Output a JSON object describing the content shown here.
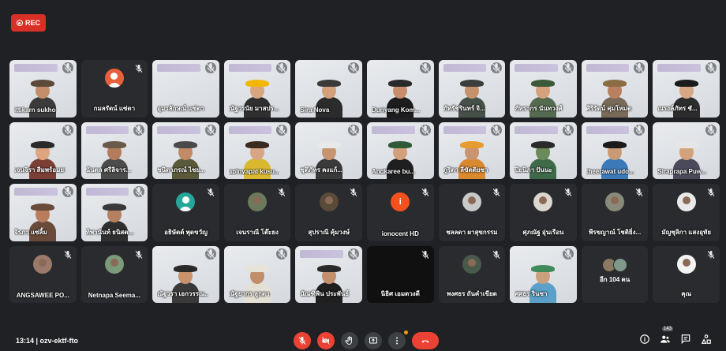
{
  "recording": {
    "label": "REC"
  },
  "meeting": {
    "time": "13:14",
    "code": "ozv-ektf-fto",
    "time_code": "13:14  |  ozv-ektf-fto"
  },
  "participants_count": "143",
  "colors": {
    "rec": "#d93025",
    "end_call": "#ea4335",
    "tile_dark": "#3c4043",
    "background": "#202124"
  },
  "participants": [
    {
      "name": "ittikarn sukho",
      "type": "video",
      "banner": true,
      "shirt": "#3b3b3b",
      "skin": "#c48e6a",
      "hat": "#5b4a3a"
    },
    {
      "name": "กมลรัตน์ แซ่ตา",
      "type": "avatar",
      "avatar_bg": "#e8603c",
      "avatar_kind": "generic"
    },
    {
      "name": "อุมาลักษณ์ แซ่ตา",
      "type": "video",
      "banner": true,
      "empty": true
    },
    {
      "name": "ณัฐวรนัย มาสปร...",
      "type": "video",
      "banner": true,
      "shirt": "#2f2f2f",
      "skin": "#d9a57e",
      "hat": "#f2b705"
    },
    {
      "name": "Sira Nova",
      "type": "video",
      "banner": false,
      "shirt": "#2b2b2b",
      "skin": "#d2a07a",
      "hat": "#3a3a3a"
    },
    {
      "name": "Duriyang Kom...",
      "type": "video",
      "banner": false,
      "shirt": "#1c1c1c",
      "skin": "#c98d6b",
      "hat": "#2a2a2a"
    },
    {
      "name": "ภัทรัชรินทร์ จิ...",
      "type": "video",
      "banner": true,
      "shirt": "#455048",
      "skin": "#c6926b",
      "hat": "#3a3f3c"
    },
    {
      "name": "ภัทรากร นันทวงศ์",
      "type": "video",
      "banner": true,
      "shirt": "#556b4f",
      "skin": "#d6a27d",
      "hat": "#3c5a3a"
    },
    {
      "name": "ศิริรัตน์ คุ่มโหมด",
      "type": "video",
      "banner": true,
      "shirt": "#7a6a5a",
      "skin": "#b88060",
      "hat": "#8a6d45"
    },
    {
      "name": "ณรงค์ภัทร ชั...",
      "type": "video",
      "banner": true,
      "shirt": "#2c2c2c",
      "skin": "#d7a684",
      "hat": "#1b1b1b"
    },
    {
      "name": "เจนจิรา สีมพร้อมยา",
      "type": "video",
      "banner": false,
      "shirt": "#7b3f35",
      "skin": "#dca47f",
      "hat": "#2a2a2a"
    },
    {
      "name": "นันตล ศรีลิจาร...",
      "type": "video",
      "banner": true,
      "shirt": "#4b4b4b",
      "skin": "#b37c5a",
      "hat": "#6a5a4a"
    },
    {
      "name": "ชนิดาภรณ์ ไชย...",
      "type": "video",
      "banner": true,
      "shirt": "#5a5a3a",
      "skin": "#c28a66",
      "hat": "#4a4a4a"
    },
    {
      "name": "apinyapat kusu...",
      "type": "video",
      "banner": true,
      "shirt": "#d9b82f",
      "skin": "#d8a684",
      "hat": "#3a2a20"
    },
    {
      "name": "ชุติภัทร คงแก้...",
      "type": "video",
      "banner": false,
      "shirt": "#3a3a3a",
      "skin": "#c79470",
      "hat": "#e8e8e8"
    },
    {
      "name": "Angkaree bu...",
      "type": "video",
      "banner": true,
      "shirt": "#1f1f1f",
      "skin": "#d4a07b",
      "hat": "#2f5a3a"
    },
    {
      "name": "ภูริตา ลีขัตติยชา",
      "type": "video",
      "banner": true,
      "shirt": "#d98a2f",
      "skin": "#c99470",
      "hat": "#e89b2e"
    },
    {
      "name": "ปิยนิภา ปันนะ",
      "type": "video",
      "banner": true,
      "shirt": "#3e6a4a",
      "skin": "#6a8a5a",
      "hat": "#2a2a2a"
    },
    {
      "name": "theerawat udo...",
      "type": "video",
      "banner": true,
      "shirt": "#3b79b8",
      "skin": "#c99a74",
      "hat": "#1b1b1b"
    },
    {
      "name": "Siraprapa Puw...",
      "type": "video",
      "banner": false,
      "shirt": "#4a4a5a",
      "skin": "#d2a27c",
      "hat": "#e6e6e6"
    },
    {
      "name": "จิรภา แซ่ลิ้ม",
      "type": "video",
      "banner": true,
      "shirt": "#6a4a3a",
      "skin": "#b97d5b",
      "hat": "#6a4a3a"
    },
    {
      "name": "ทิพานันท์ ธนิสด...",
      "type": "video",
      "banner": true,
      "shirt": "#2f2f2f",
      "skin": "#b5805f",
      "hat": "#3a3a3a"
    },
    {
      "name": "อธิษัตต์ พุดขวัญ",
      "type": "avatar",
      "avatar_bg": "#26a69a",
      "avatar_kind": "generic"
    },
    {
      "name": "เจนราณี โต๊ะยง",
      "type": "avatar",
      "avatar_bg": "#6b7a5a",
      "avatar_kind": "photo"
    },
    {
      "name": "สุปราณี คุ้มวงษ์",
      "type": "avatar",
      "avatar_bg": "#5a4a3a",
      "avatar_kind": "photo"
    },
    {
      "name": "ionocent HD",
      "type": "avatar",
      "avatar_bg": "#f4511e",
      "avatar_kind": "letter",
      "letter": "i"
    },
    {
      "name": "ชลลดา ผาสุขกรรม",
      "type": "avatar",
      "avatar_bg": "#c9c9c9",
      "avatar_kind": "photo"
    },
    {
      "name": "ศุภณัฐ อุ่นเรือน",
      "type": "avatar",
      "avatar_bg": "#ddd8cf",
      "avatar_kind": "photo"
    },
    {
      "name": "พีรขญาณ์ โชติยิ่ง...",
      "type": "avatar",
      "avatar_bg": "#8a8a7a",
      "avatar_kind": "photo"
    },
    {
      "name": "มัญชุลิกา แสงอุทัย",
      "type": "avatar",
      "avatar_bg": "#e9e9e9",
      "avatar_kind": "photo"
    },
    {
      "name": "ANGSAWEE PO...",
      "type": "avatar",
      "avatar_bg": "#9a7a6a",
      "avatar_kind": "photo"
    },
    {
      "name": "Netnapa Seema...",
      "type": "avatar",
      "avatar_bg": "#7a9a7a",
      "avatar_kind": "photo"
    },
    {
      "name": "ณัฐวรา เอกวรรณ...",
      "type": "video",
      "banner": false,
      "shirt": "#3a3a3a",
      "skin": "#c8926c",
      "hat": "#2a2a2a"
    },
    {
      "name": "ณัฐยากร ลูกดา",
      "type": "video",
      "banner": false,
      "shirt": "#e5e0d5",
      "skin": "#c28d69",
      "hat": "#e8e3d8"
    },
    {
      "name": "นัณฑิพิน ประพันธ์",
      "type": "video",
      "banner": true,
      "shirt": "#1f1f1f",
      "skin": "#c3906e",
      "hat": "#2a2a2a"
    },
    {
      "name": "นิธิศ เอมดวงดี",
      "type": "black"
    },
    {
      "name": "พงศธร ถันคำเขียด",
      "type": "avatar",
      "avatar_bg": "#4a5a4a",
      "avatar_kind": "photo"
    },
    {
      "name": "ศศธร รินชา",
      "type": "video",
      "banner": false,
      "shirt": "#5aa0c8",
      "skin": "#caa07e",
      "hat": "#3f8a5a"
    },
    {
      "name": "อีก 104 คน",
      "type": "more"
    },
    {
      "name": "คุณ",
      "type": "avatar",
      "avatar_bg": "#f3f3f3",
      "avatar_kind": "photo"
    }
  ],
  "controls": [
    "mic-off-icon",
    "camera-off-icon",
    "raise-hand-icon",
    "present-icon",
    "more-options-icon",
    "end-call-icon"
  ],
  "right_controls": [
    "info-icon",
    "people-icon",
    "chat-icon",
    "activities-icon"
  ]
}
